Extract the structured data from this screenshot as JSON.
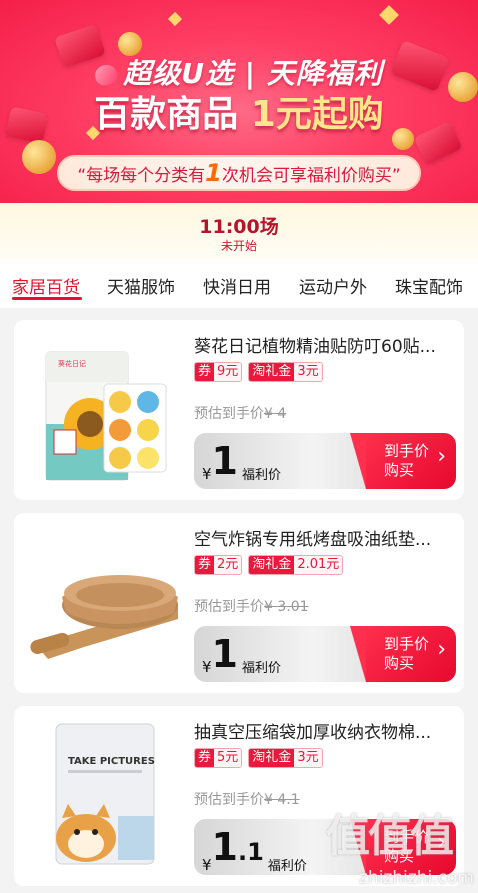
{
  "banner": {
    "brand": "超级U选",
    "divider": "|",
    "slogan": "天降福利",
    "headline_prefix": "百款商品",
    "headline_highlight": "1元起购",
    "notice_prefix": "“每场每个分类有",
    "notice_number": "1",
    "notice_suffix": "次机会可享福利价购买”"
  },
  "session": {
    "time": "11:00场",
    "status": "未开始"
  },
  "tabs": [
    "家居百货",
    "天猫服饰",
    "快消日用",
    "运动户外",
    "珠宝配饰"
  ],
  "active_tab": 0,
  "products": [
    {
      "title": "葵花日记植物精油贴防叮60贴...",
      "coupon_label": "券",
      "coupon_amount": "9元",
      "gift_label": "淘礼金",
      "gift_amount": "3元",
      "est_label": "预估到手价",
      "est_price": "¥ 4",
      "currency": "¥",
      "price": "1",
      "price_label": "福利价",
      "buy_label_1": "到手价",
      "buy_label_2": "购买",
      "image_brand": "葵花日记"
    },
    {
      "title": "空气炸锅专用纸烤盘吸油纸垫...",
      "coupon_label": "券",
      "coupon_amount": "2元",
      "gift_label": "淘礼金",
      "gift_amount": "2.01元",
      "est_label": "预估到手价",
      "est_price": "¥ 3.01",
      "currency": "¥",
      "price": "1",
      "price_label": "福利价",
      "buy_label_1": "到手价",
      "buy_label_2": "购买"
    },
    {
      "title": "抽真空压缩袋加厚收纳衣物棉...",
      "coupon_label": "券",
      "coupon_amount": "5元",
      "gift_label": "淘礼金",
      "gift_amount": "3元",
      "est_label": "预估到手价",
      "est_price": "¥ 4.1",
      "currency": "¥",
      "price": "1",
      "price_decimal": ".1",
      "price_label": "福利价",
      "buy_label_1": "到手价",
      "buy_label_2": "购买",
      "image_text": "TAKE PICTURES"
    }
  ],
  "watermark": {
    "logo": "值值值",
    "domain": "zhizhizhi.com"
  },
  "colors": {
    "brand_red": "#e3122f",
    "banner_pink": "#ff3d63",
    "coupon_red": "#e8193c"
  }
}
